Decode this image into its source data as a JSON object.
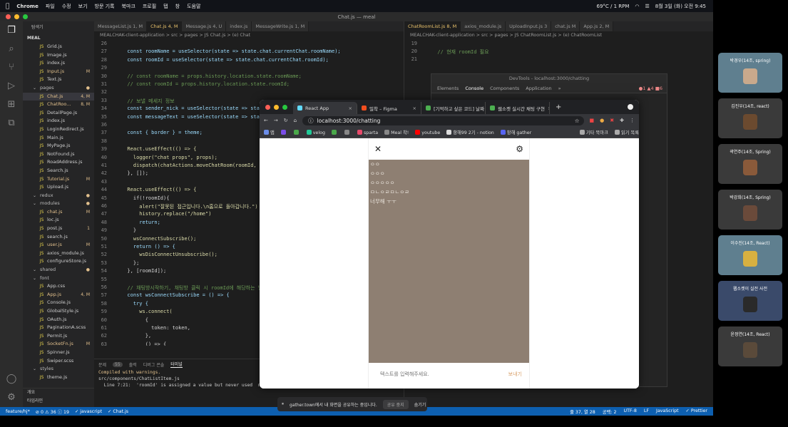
{
  "menubar": {
    "app": "Chrome",
    "items": [
      "파일",
      "수정",
      "보기",
      "방문 기록",
      "북마크",
      "프로필",
      "탭",
      "창",
      "도움말"
    ],
    "weather": "69°C / 1 RPM",
    "datetime": "8월 3일 (화) 오전 9:45"
  },
  "vscode": {
    "window_title": "Chat.js — meal",
    "explorer_header": "탐색기",
    "root": "MEAL",
    "tree": [
      {
        "name": "Grid.js",
        "badge": "",
        "type": "file"
      },
      {
        "name": "Image.js",
        "badge": "",
        "type": "file"
      },
      {
        "name": "index.js",
        "badge": "",
        "type": "file"
      },
      {
        "name": "Input.js",
        "badge": "M",
        "type": "file"
      },
      {
        "name": "Text.js",
        "badge": "",
        "type": "file"
      },
      {
        "name": "pages",
        "badge": "●",
        "type": "folder"
      },
      {
        "name": "Chat.js",
        "badge": "4, M",
        "type": "file",
        "selected": true
      },
      {
        "name": "ChatRoo...",
        "badge": "8, M",
        "type": "file"
      },
      {
        "name": "DetailPage.js",
        "badge": "",
        "type": "file"
      },
      {
        "name": "index.js",
        "badge": "",
        "type": "file"
      },
      {
        "name": "LoginRedirect.js",
        "badge": "",
        "type": "file"
      },
      {
        "name": "Main.js",
        "badge": "",
        "type": "file"
      },
      {
        "name": "MyPage.js",
        "badge": "",
        "type": "file"
      },
      {
        "name": "NotFound.js",
        "badge": "",
        "type": "file"
      },
      {
        "name": "RoadAddress.js",
        "badge": "",
        "type": "file"
      },
      {
        "name": "Search.js",
        "badge": "",
        "type": "file"
      },
      {
        "name": "Tutorial.js",
        "badge": "M",
        "type": "file"
      },
      {
        "name": "Upload.js",
        "badge": "",
        "type": "file"
      },
      {
        "name": "redux",
        "badge": "●",
        "type": "folder"
      },
      {
        "name": "modules",
        "badge": "●",
        "type": "folder"
      },
      {
        "name": "chat.js",
        "badge": "M",
        "type": "file"
      },
      {
        "name": "loc.js",
        "badge": "",
        "type": "file"
      },
      {
        "name": "post.js",
        "badge": "1",
        "type": "file"
      },
      {
        "name": "search.js",
        "badge": "",
        "type": "file"
      },
      {
        "name": "user.js",
        "badge": "M",
        "type": "file"
      },
      {
        "name": "axios_module.js",
        "badge": "",
        "type": "file"
      },
      {
        "name": "configureStore.js",
        "badge": "",
        "type": "file"
      },
      {
        "name": "shared",
        "badge": "●",
        "type": "folder"
      },
      {
        "name": "font",
        "badge": "",
        "type": "folder"
      },
      {
        "name": "App.css",
        "badge": "",
        "type": "file"
      },
      {
        "name": "App.js",
        "badge": "4, M",
        "type": "file"
      },
      {
        "name": "Console.js",
        "badge": "",
        "type": "file"
      },
      {
        "name": "GlobalStyle.js",
        "badge": "",
        "type": "file"
      },
      {
        "name": "OAuth.js",
        "badge": "",
        "type": "file"
      },
      {
        "name": "PaginationA.scss",
        "badge": "",
        "type": "file"
      },
      {
        "name": "Permit.js",
        "badge": "",
        "type": "file"
      },
      {
        "name": "SocketFn.js",
        "badge": "M",
        "type": "file"
      },
      {
        "name": "Spinner.js",
        "badge": "",
        "type": "file"
      },
      {
        "name": "Swiper.scss",
        "badge": "",
        "type": "file"
      },
      {
        "name": "styles",
        "badge": "",
        "type": "folder"
      },
      {
        "name": "theme.js",
        "badge": "",
        "type": "file"
      }
    ],
    "sidebar_footer": [
      "개요",
      "타임라인"
    ],
    "tabs_left": [
      {
        "label": "MessageList.js 1, M",
        "active": false
      },
      {
        "label": "Chat.js 4, M",
        "active": true
      },
      {
        "label": "Message.js 4, U",
        "active": false
      },
      {
        "label": "index.js",
        "active": false
      },
      {
        "label": "MessageWrite.js 1, M",
        "active": false
      }
    ],
    "breadcrumb_left": "MEALCHAK-client-application > src > pages > JS Chat.js > (e) Chat",
    "code": [
      {
        "n": "26",
        "t": ""
      },
      {
        "n": "27",
        "t": "  const roomName = useSelector(state => state.chat.currentChat.roomName);"
      },
      {
        "n": "28",
        "t": "  const roomId = useSelector(state => state.chat.currentChat.roomId);"
      },
      {
        "n": "29",
        "t": ""
      },
      {
        "n": "30",
        "t": "  // const roomName = props.history.location.state.roomName;"
      },
      {
        "n": "31",
        "t": "  // const roomId = props.history.location.state.roomId;"
      },
      {
        "n": "32",
        "t": ""
      },
      {
        "n": "33",
        "t": "  // 보낼 메세지 정보"
      },
      {
        "n": "34",
        "t": "  const sender_nick = useSelector(state => sta"
      },
      {
        "n": "35",
        "t": "  const messageText = useSelector(state => sta"
      },
      {
        "n": "36",
        "t": ""
      },
      {
        "n": "37",
        "t": "  const { border } = theme;"
      },
      {
        "n": "38",
        "t": ""
      },
      {
        "n": "39",
        "t": "  React.useEffect(() => {"
      },
      {
        "n": "40",
        "t": "    logger(\"chat props\", props);"
      },
      {
        "n": "41",
        "t": "    dispatch(chatActions.moveChatRoom(roomId,"
      },
      {
        "n": "42",
        "t": "  }, []);"
      },
      {
        "n": "43",
        "t": ""
      },
      {
        "n": "44",
        "t": "  React.useEffect(() => {"
      },
      {
        "n": "45",
        "t": "    if(!roomId){"
      },
      {
        "n": "46",
        "t": "      alert(\"잘못된 접근입니다.\\n홈으로 돌아갑니다.\")"
      },
      {
        "n": "47",
        "t": "      history.replace(\"/home\")"
      },
      {
        "n": "48",
        "t": "      return;"
      },
      {
        "n": "49",
        "t": "    }"
      },
      {
        "n": "50",
        "t": "    wsConnectSubscribe();"
      },
      {
        "n": "51",
        "t": "    return () => {"
      },
      {
        "n": "52",
        "t": "      wsDisConnectUnsubscribe();"
      },
      {
        "n": "53",
        "t": "    };"
      },
      {
        "n": "54",
        "t": "  }, [roomId]);"
      },
      {
        "n": "55",
        "t": ""
      },
      {
        "n": "56",
        "t": "  // 채팅방시작하기, 채팅방 클릭 시 roomId에 해당하는 방"
      },
      {
        "n": "57",
        "t": "  const wsConnectSubscribe = () => {"
      },
      {
        "n": "58",
        "t": "    try {"
      },
      {
        "n": "59",
        "t": "      ws.connect("
      },
      {
        "n": "60",
        "t": "        {"
      },
      {
        "n": "61",
        "t": "          token: token,"
      },
      {
        "n": "62",
        "t": "        },"
      },
      {
        "n": "63",
        "t": "        () => {"
      },
      {
        "n": "64",
        "t": "          ws.subscribe("
      },
      {
        "n": "65",
        "t": "            `/sub/api/chat/rooms/${roomId}`,"
      },
      {
        "n": "66",
        "t": "            (data) => {"
      }
    ],
    "terminal_tabs": [
      "문제",
      "55",
      "출력",
      "디버그 콘솔",
      "터미널"
    ],
    "terminal_lines": [
      "Compiled with warnings.",
      "",
      "src/components/ChatListItem.js",
      "  Line 7:21:  'roomId' is assigned a value but never used  no-unused-"
    ],
    "tabs_right": [
      {
        "label": "ChatRoomList.js 8, M",
        "active": true
      },
      {
        "label": "axios_module.js",
        "active": false
      },
      {
        "label": "UploadInput.js 3",
        "active": false
      },
      {
        "label": "chat.js M",
        "active": false
      },
      {
        "label": "App.js 2, M",
        "active": false
      }
    ],
    "breadcrumb_right": "MEALCHAK-client-application > src > pages > JS ChatRoomList.js > (e) ChatRoomList",
    "code_right": [
      {
        "n": "19",
        "t": ""
      },
      {
        "n": "20",
        "t": "  // 현재 roomId 필요"
      },
      {
        "n": "21",
        "t": ""
      }
    ],
    "statusbar_left": [
      "feature/hj*",
      "⊘ 0 ⚠ 36 ⓘ 19",
      "✓ javascript",
      "✓ Chat.js"
    ],
    "statusbar_right": [
      "줄 37, 열 28",
      "공백: 2",
      "UTF-8",
      "LF",
      "JavaScript",
      "✓ Prettier"
    ]
  },
  "devtools": {
    "title": "DevTools - localhost:3000/chatting",
    "tabs": [
      "Elements",
      "Console",
      "Components",
      "Application",
      "»"
    ],
    "badges": "●1 ▲4 ■6"
  },
  "browser": {
    "tabs": [
      {
        "label": "React App",
        "color": "#61dafb",
        "active": true
      },
      {
        "label": "밀착 – Figma",
        "color": "#f24e1e",
        "active": false
      },
      {
        "label": "[기억하고 싶은 코드] 날짜",
        "color": "#4caf50",
        "active": false
      },
      {
        "label": "웹소켓 실시간 채팅 구현",
        "color": "#4caf50",
        "active": false
      }
    ],
    "url": "localhost:3000/chatting",
    "bookmarks": [
      {
        "label": "앱",
        "color": "#6b8de8"
      },
      {
        "label": "",
        "color": "#7b4de8"
      },
      {
        "label": "",
        "color": "#4aa84a"
      },
      {
        "label": "velog",
        "color": "#20c997"
      },
      {
        "label": "",
        "color": "#4aa84a"
      },
      {
        "label": "",
        "color": "#888888"
      },
      {
        "label": "sparta",
        "color": "#e84a6b"
      },
      {
        "label": "Meal 착!",
        "color": "#888888"
      },
      {
        "label": "youtube",
        "color": "#ff0000"
      },
      {
        "label": "항해99 2기 - notion",
        "color": "#dddddd"
      },
      {
        "label": "항해 gather",
        "color": "#5865f2"
      },
      {
        "label": "기타 북마크",
        "color": "#aaaaaa"
      },
      {
        "label": "읽기 목록",
        "color": "#aaaaaa"
      }
    ]
  },
  "chat": {
    "messages": [
      "ㅇㅇ",
      "ㅇㅇㅇ",
      "ㅇㅇㅇㅇㅇ",
      "ㅁㄴㅇㄹㅁㄴㅇㄹ",
      "너무해 ㅜㅜ"
    ],
    "input_placeholder": "텍스트를 입력해주세요.",
    "send_label": "보내기",
    "bg_color": "#8e7f72"
  },
  "share_bar": {
    "text": "gather.town에서 내 화면을 공유하는 중입니다.",
    "stop": "공유 중지",
    "hide": "숨기기"
  },
  "gather": {
    "participants": [
      "박경우(14조, spring)",
      "김진우(14조, react)",
      "곽연주(14조, Spring)",
      "박강희(14조, Spring)",
      "이수진(14조, React)",
      "웹소켓이 실전 사전",
      "윤정연(14조, React)"
    ]
  }
}
